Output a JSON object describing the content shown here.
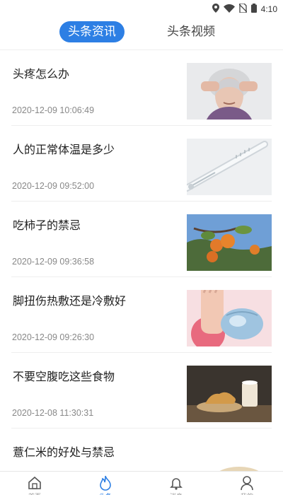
{
  "status_bar": {
    "time": "4:10",
    "icons": [
      "location-icon",
      "wifi-icon",
      "no-sim-icon",
      "battery-icon"
    ]
  },
  "tabs": [
    {
      "label": "头条资讯",
      "active": true
    },
    {
      "label": "头条视频",
      "active": false
    }
  ],
  "feed": [
    {
      "title": "头疼怎么办",
      "time": "2020-12-09 10:06:49",
      "thumb": "woman-headache"
    },
    {
      "title": "人的正常体温是多少",
      "time": "2020-12-09 09:52:00",
      "thumb": "thermometer"
    },
    {
      "title": "吃柿子的禁忌",
      "time": "2020-12-09 09:36:58",
      "thumb": "persimmon-tree"
    },
    {
      "title": "脚扭伤热敷还是冷敷好",
      "time": "2020-12-09 09:26:30",
      "thumb": "ankle-ice-pack"
    },
    {
      "title": "不要空腹吃这些食物",
      "time": "2020-12-08 11:30:31",
      "thumb": "snack-plate"
    },
    {
      "title": "薏仁米的好处与禁忌",
      "time": "",
      "thumb": "barley-grains"
    }
  ],
  "bottom_nav": [
    {
      "label": "首页",
      "icon": "home-icon",
      "active": false
    },
    {
      "label": "头条",
      "icon": "flame-icon",
      "active": true
    },
    {
      "label": "消息",
      "icon": "bell-icon",
      "active": false
    },
    {
      "label": "我的",
      "icon": "user-icon",
      "active": false
    }
  ],
  "colors": {
    "accent": "#2d7fe4",
    "text": "#222222",
    "muted": "#888888"
  }
}
